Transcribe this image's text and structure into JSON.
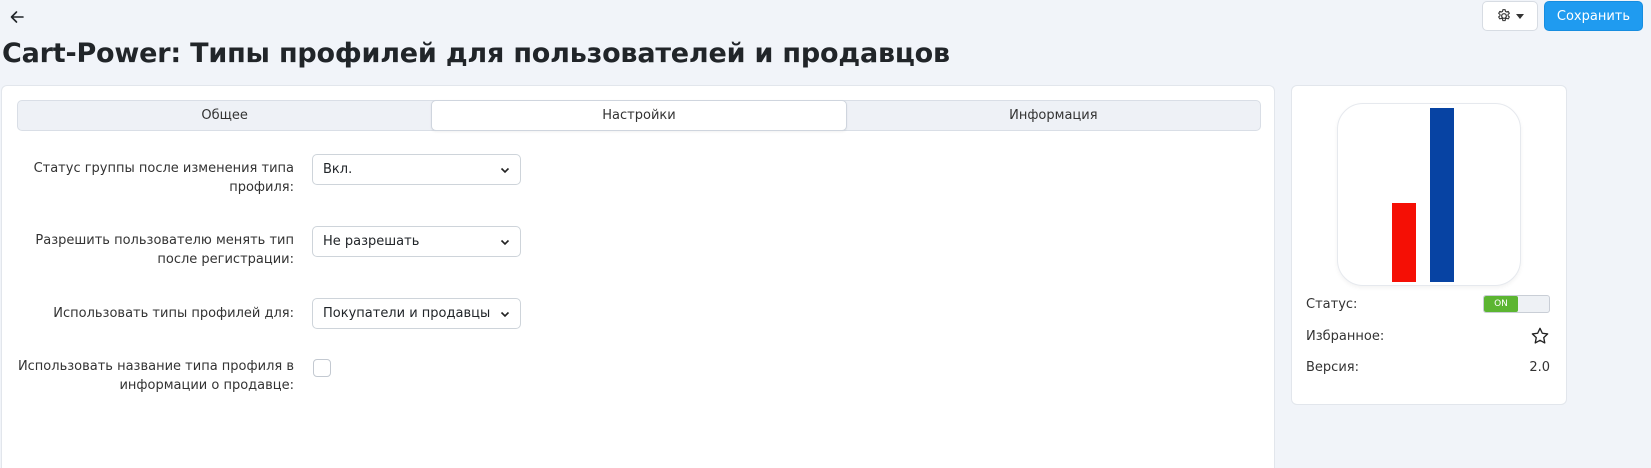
{
  "header": {
    "title": "Cart-Power: Типы профилей для пользователей и продавцов",
    "save_label": "Сохранить",
    "colors": {
      "accent": "#1f9bf0",
      "background": "#f1f4f9"
    }
  },
  "tabs": [
    {
      "label": "Общее",
      "active": false
    },
    {
      "label": "Настройки",
      "active": true
    },
    {
      "label": "Информация",
      "active": false
    }
  ],
  "settings": {
    "group_status": {
      "label": "Статус группы после изменения типа профиля:",
      "value": "Вкл."
    },
    "allow_change": {
      "label": "Разрешить пользователю менять тип после регистрации:",
      "value": "Не разрешать"
    },
    "use_for": {
      "label": "Использовать типы профилей для:",
      "value": "Покупатели и продавцы"
    },
    "vendor_info": {
      "label": "Использовать название типа профиля в информации о продавце:",
      "checked": false
    }
  },
  "addon": {
    "logo": {
      "bar_colors": [
        "#f50f05",
        "#0743a3"
      ]
    },
    "status_label": "Статус:",
    "status_value": "ON",
    "status_color": "#5cb531",
    "favorite_label": "Избранное:",
    "version_label": "Версия:",
    "version_value": "2.0"
  },
  "icons": [
    "arrow-left-icon",
    "gear-icon",
    "chevron-down-icon",
    "star-icon"
  ]
}
